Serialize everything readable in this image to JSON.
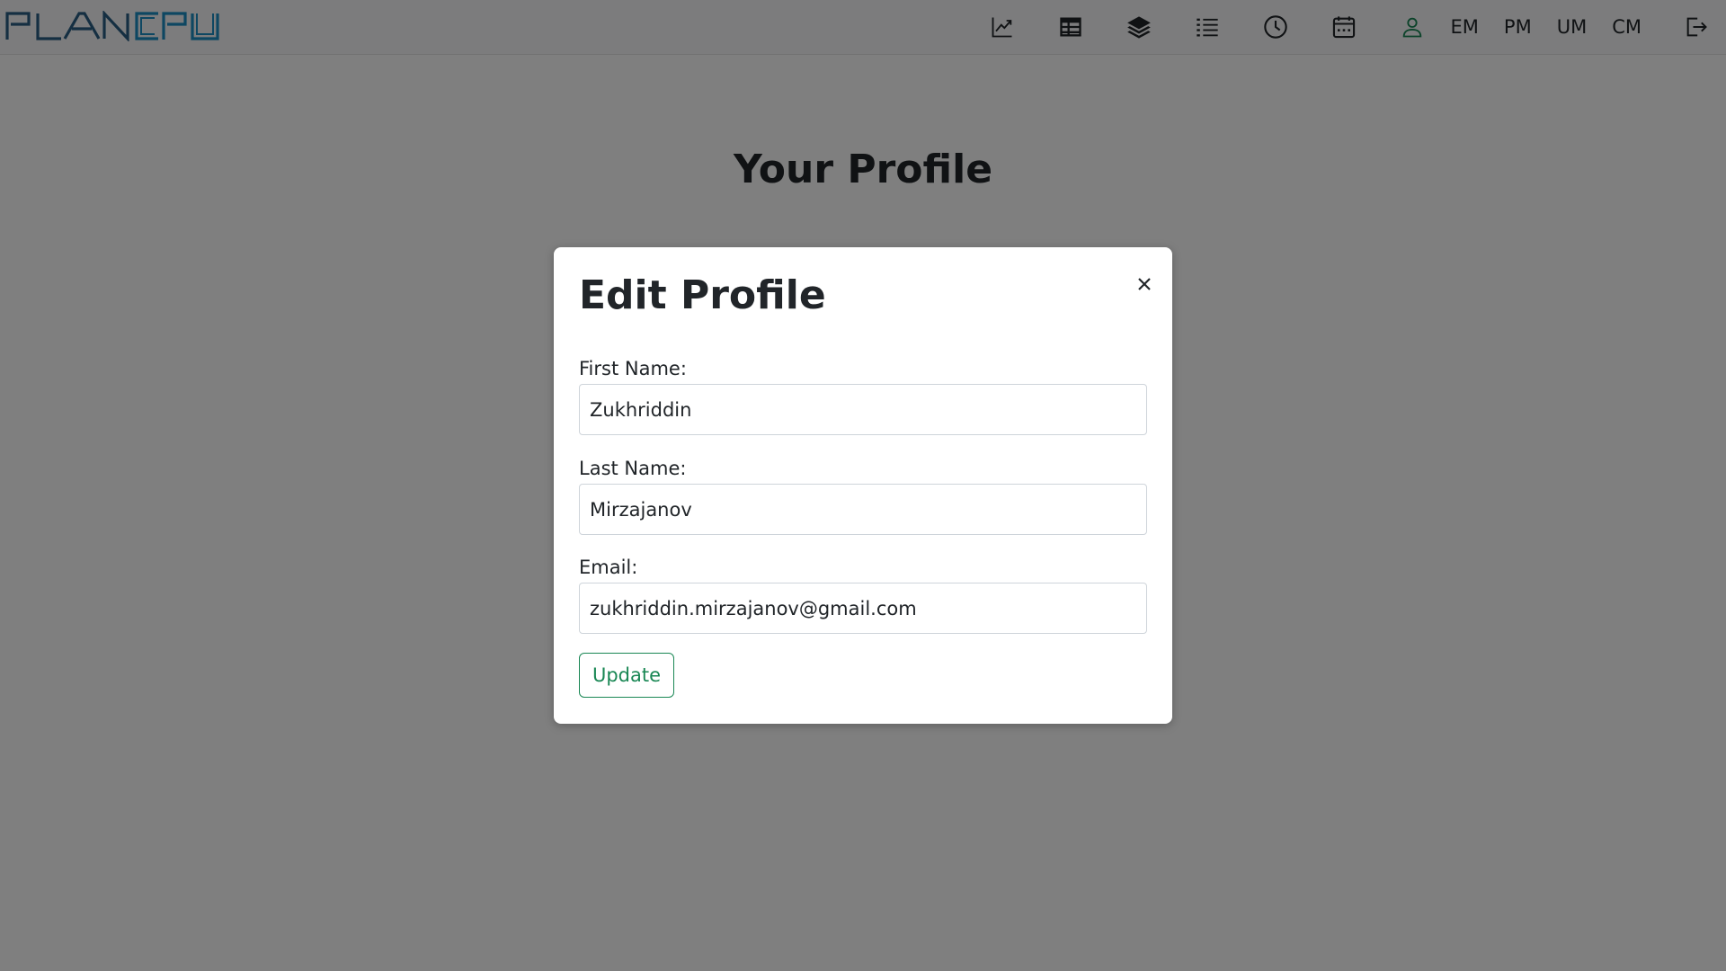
{
  "app": {
    "logo_text": "PLANCPU"
  },
  "nav": {
    "icons": [
      "chart-line-icon",
      "table-icon",
      "layers-icon",
      "list-icon",
      "clock-icon",
      "calendar-icon",
      "user-icon"
    ],
    "links": [
      "EM",
      "PM",
      "UM",
      "CM"
    ],
    "logout_icon": "logout-icon"
  },
  "main": {
    "title": "Your Profile"
  },
  "modal": {
    "title": "Edit Profile",
    "close_icon": "close-icon",
    "fields": [
      {
        "label": "First Name:",
        "value": "Zukhriddin"
      },
      {
        "label": "Last Name:",
        "value": "Mirzajanov"
      },
      {
        "label": "Email:",
        "value": "zukhriddin.mirzajanov@gmail.com"
      }
    ],
    "submit_label": "Update"
  },
  "colors": {
    "accent_green": "#198754",
    "logo_blue": "#1a6fa8",
    "overlay": "rgba(0,0,0,0.5)"
  }
}
